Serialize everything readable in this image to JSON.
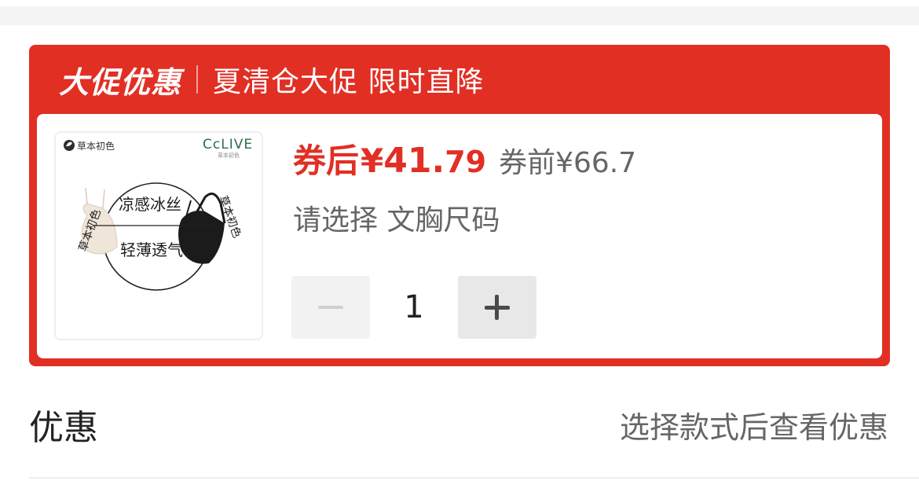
{
  "promo": {
    "title": "大促优惠",
    "subtitle": "夏清仓大促 限时直降",
    "accent_color": "#e12f24"
  },
  "product": {
    "image": {
      "brand_cn": "草本初色",
      "brand_logo": "CcLIVE",
      "brand_logo_sub": "草本初色",
      "feature_1": "凉感冰丝",
      "feature_2": "轻薄透气",
      "ring_text_left": "草本初色",
      "ring_text_right": "草本初色",
      "leaf-icon": "leaf-icon"
    },
    "price_after_label": "券后",
    "price_symbol": "¥",
    "price_after_int": "41.",
    "price_after_dec": "79",
    "price_before": "券前¥66.7",
    "select_hint": "请选择 文胸尺码",
    "quantity": "1",
    "minus_icon": "minus-icon",
    "plus_icon": "plus-icon"
  },
  "discount": {
    "label": "优惠",
    "hint": "选择款式后查看优惠"
  }
}
